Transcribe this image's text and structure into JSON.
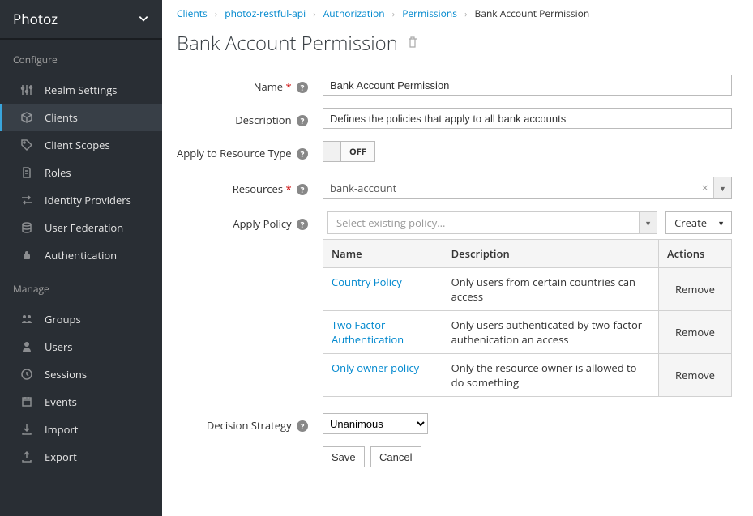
{
  "realm": {
    "name": "Photoz"
  },
  "sidebar": {
    "sections": {
      "configure": {
        "label": "Configure",
        "items": [
          {
            "label": "Realm Settings"
          },
          {
            "label": "Clients",
            "active": true
          },
          {
            "label": "Client Scopes"
          },
          {
            "label": "Roles"
          },
          {
            "label": "Identity Providers"
          },
          {
            "label": "User Federation"
          },
          {
            "label": "Authentication"
          }
        ]
      },
      "manage": {
        "label": "Manage",
        "items": [
          {
            "label": "Groups"
          },
          {
            "label": "Users"
          },
          {
            "label": "Sessions"
          },
          {
            "label": "Events"
          },
          {
            "label": "Import"
          },
          {
            "label": "Export"
          }
        ]
      }
    }
  },
  "breadcrumb": {
    "items": [
      {
        "label": "Clients",
        "link": true
      },
      {
        "label": "photoz-restful-api",
        "link": true
      },
      {
        "label": "Authorization",
        "link": true
      },
      {
        "label": "Permissions",
        "link": true
      },
      {
        "label": "Bank Account Permission",
        "link": false
      }
    ]
  },
  "page": {
    "title": "Bank Account Permission"
  },
  "form": {
    "name": {
      "label": "Name",
      "value": "Bank Account Permission"
    },
    "description": {
      "label": "Description",
      "value": "Defines the policies that apply to all bank accounts"
    },
    "applyResourceType": {
      "label": "Apply to Resource Type",
      "switch": "OFF"
    },
    "resources": {
      "label": "Resources",
      "value": "bank-account"
    },
    "applyPolicy": {
      "label": "Apply Policy",
      "placeholder": "Select existing policy...",
      "createLabel": "Create",
      "table": {
        "headers": {
          "name": "Name",
          "description": "Description",
          "actions": "Actions"
        },
        "removeLabel": "Remove",
        "rows": [
          {
            "name": "Country Policy",
            "description": "Only users from certain countries can access"
          },
          {
            "name": "Two Factor Authentication",
            "description": "Only users authenticated by two-factor authenication an access"
          },
          {
            "name": "Only owner policy",
            "description": "Only the resource owner is allowed to do something"
          }
        ]
      }
    },
    "decisionStrategy": {
      "label": "Decision Strategy",
      "value": "Unanimous"
    },
    "buttons": {
      "save": "Save",
      "cancel": "Cancel"
    }
  }
}
